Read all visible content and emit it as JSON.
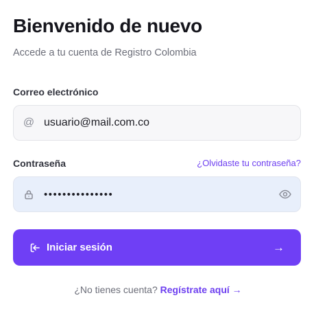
{
  "header": {
    "title": "Bienvenido de nuevo",
    "subtitle": "Accede a tu cuenta de Registro Colombia"
  },
  "email": {
    "label": "Correo electrónico",
    "value": "usuario@mail.com.co",
    "icon": "at-icon"
  },
  "password": {
    "label": "Contraseña",
    "forgot_link": "¿Olvidaste tu contraseña?",
    "value": "•••••••••••••••",
    "icon": "lock-icon",
    "toggle_icon": "eye-icon"
  },
  "submit": {
    "label": "Iniciar sesión",
    "icon": "login-icon",
    "arrow": "→",
    "color": "#6f3ff5"
  },
  "signup": {
    "prompt": "¿No tienes cuenta?",
    "link": "Regístrate aquí →"
  },
  "colors": {
    "accent": "#6d3ff0",
    "password_field_bg": "#e8effb",
    "email_field_bg": "#f7f7f9"
  }
}
